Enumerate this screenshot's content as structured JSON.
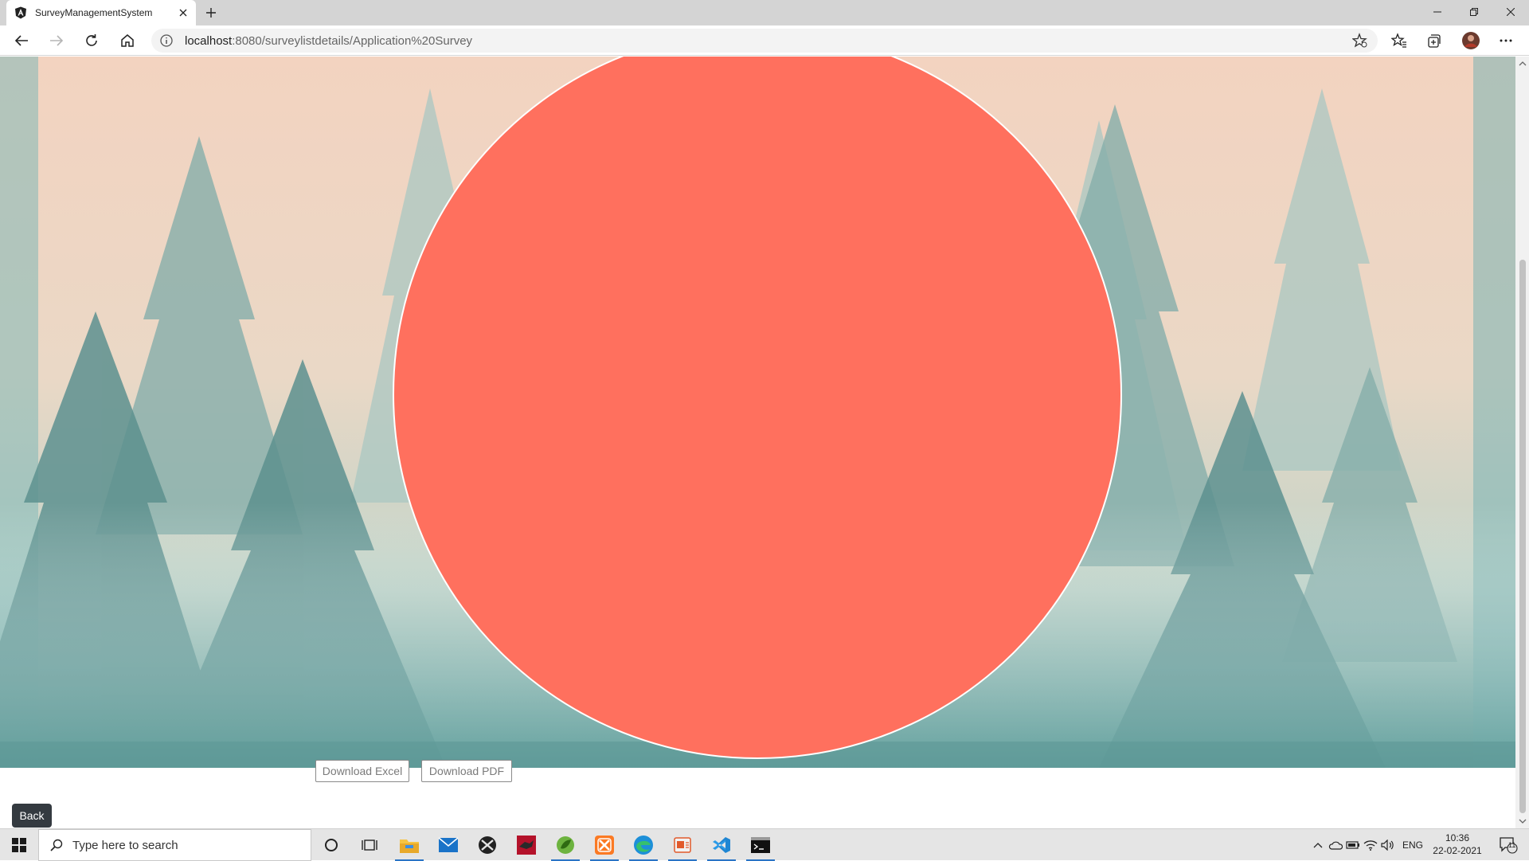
{
  "browser": {
    "tab_title": "SurveyManagementSystem",
    "url_host": "localhost",
    "url_rest": ":8080/surveylistdetails/Application%20Survey"
  },
  "page": {
    "download_excel_label": "Download Excel",
    "download_pdf_label": "Download PDF",
    "back_label": "Back"
  },
  "chart_data": {
    "type": "pie",
    "values": [
      0.001,
      99.999
    ],
    "colors": [
      "#ffffff",
      "#ff705e"
    ]
  },
  "taskbar": {
    "search_placeholder": "Type here to search",
    "language": "ENG",
    "time": "10:36",
    "date": "22-02-2021",
    "notification_count": "11"
  },
  "colors": {
    "accent": "#2a74c6",
    "pie_fill": "#ff705e",
    "back_button": "#343a40"
  }
}
